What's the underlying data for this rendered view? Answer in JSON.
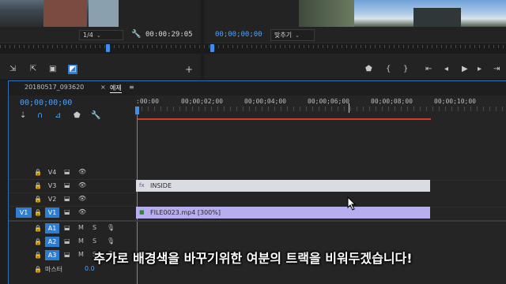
{
  "source_monitor": {
    "zoom": "1/4",
    "timecode": "00:00:29:05"
  },
  "program_monitor": {
    "timecode": "00;00;00;00",
    "fit": "맞추기"
  },
  "timeline": {
    "tabs": [
      "20180517_093620",
      "예제"
    ],
    "close_icon": "×",
    "menu_icon": "≡",
    "timecode": "00;00;00;00",
    "ruler_labels": [
      ":00:00",
      "00;00;02;00",
      "00;00;04;00",
      "00;00;06;00",
      "00;00;08;00",
      "00;00;10;00"
    ],
    "video_tracks": [
      {
        "name": "V4",
        "selected": false
      },
      {
        "name": "V3",
        "selected": false
      },
      {
        "name": "V2",
        "selected": false
      },
      {
        "name": "V1",
        "selected": true,
        "target": "V1"
      }
    ],
    "audio_tracks": [
      {
        "name": "A1",
        "m": "M",
        "s": "S"
      },
      {
        "name": "A2",
        "m": "M",
        "s": "S"
      },
      {
        "name": "A3",
        "m": "M",
        "s": "S"
      }
    ],
    "master": {
      "label": "마스터",
      "value": "0.0"
    },
    "clips": {
      "v3": "INSIDE",
      "v1": "FILE0023.mp4 [300%]"
    }
  },
  "subtitle": "추가로 배경색을 바꾸기위한 여분의 트랙을 비워두겠습니다!",
  "colors": {
    "accent": "#2d7dd2",
    "timecode_blue": "#4aa3ff",
    "work_area": "#d43b2a",
    "clip_graphic": "#d9dde2",
    "clip_video": "#b7aef0"
  }
}
